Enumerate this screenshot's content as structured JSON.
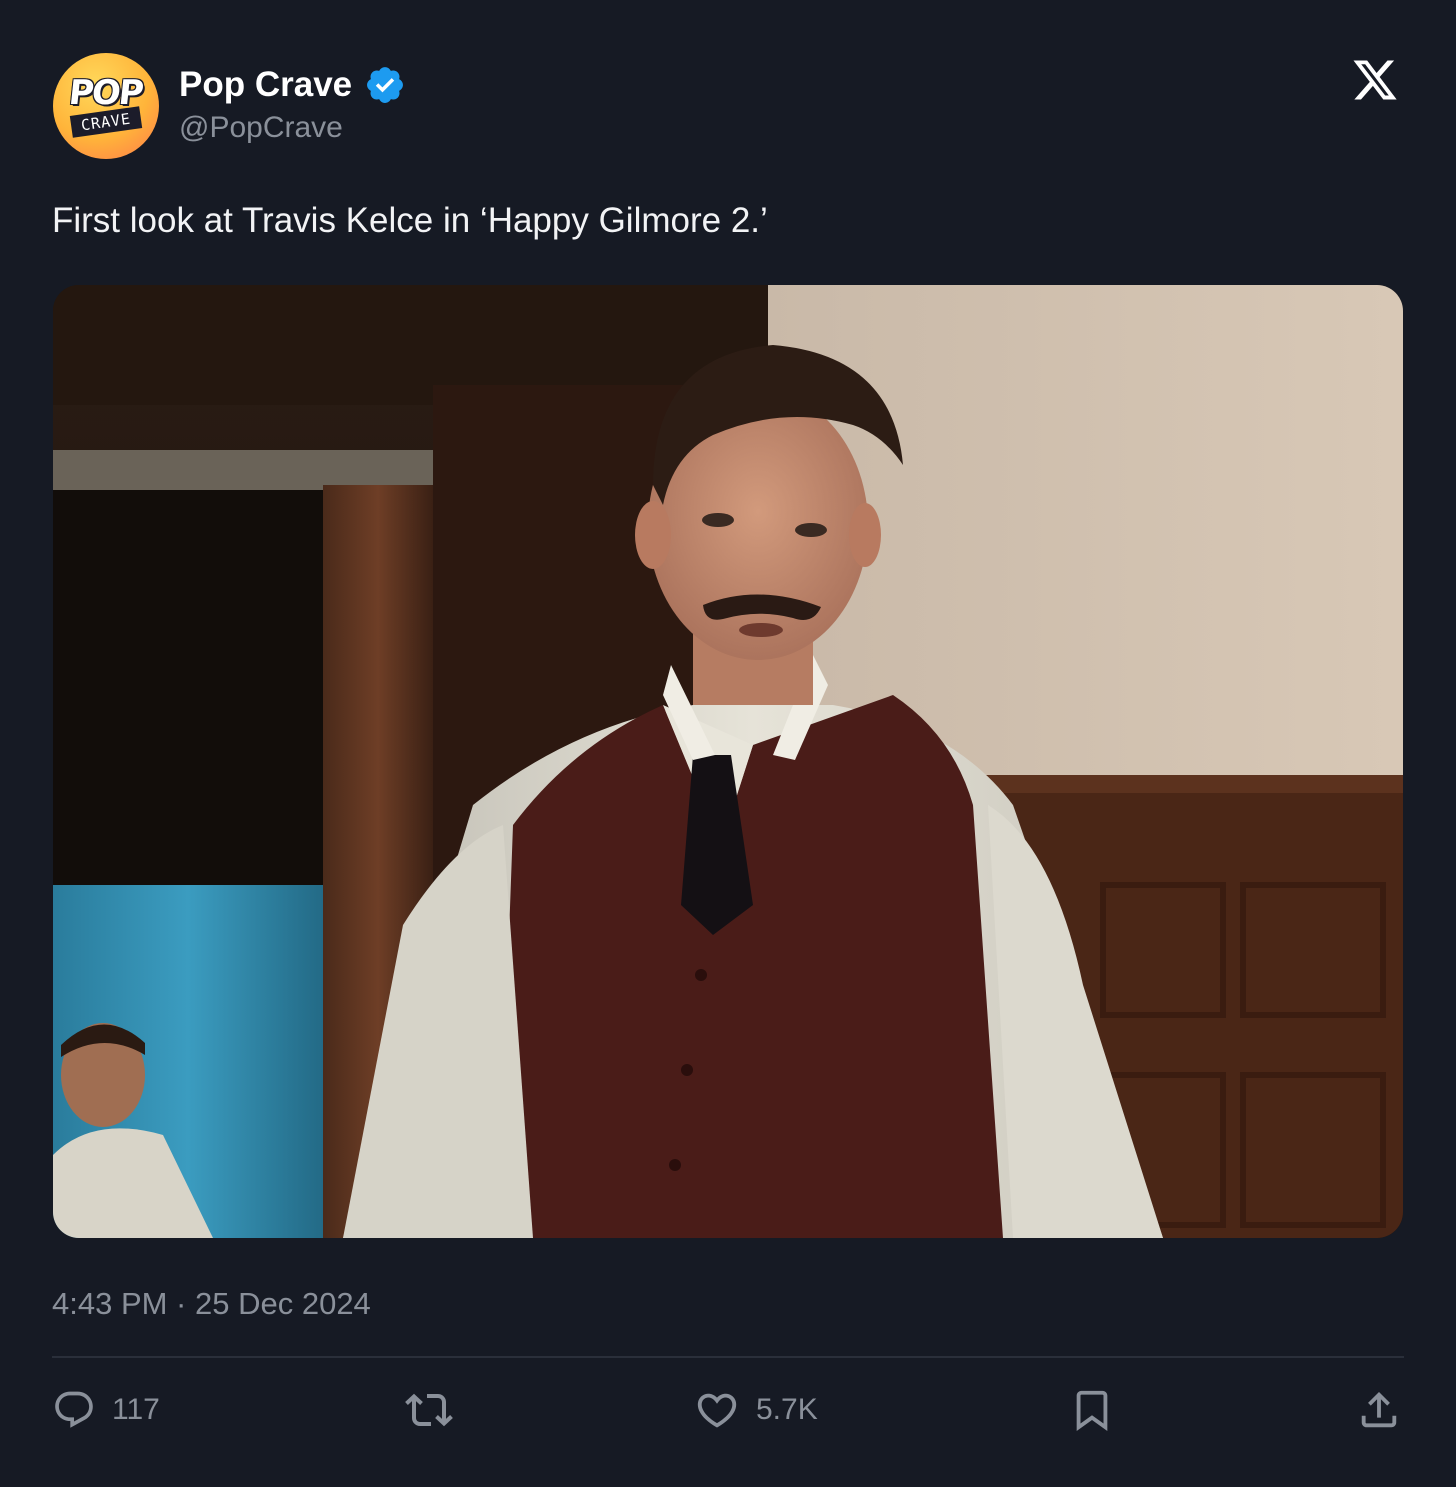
{
  "account": {
    "avatar_top": "POP",
    "avatar_bottom": "CRAVE",
    "display_name": "Pop Crave",
    "handle": "@PopCrave",
    "verified_icon": "verified-badge-icon",
    "platform_icon": "x-logo-icon"
  },
  "post": {
    "text": "First look at Travis Kelce in ‘Happy Gilmore 2.’",
    "timestamp": "4:43 PM · 25 Dec 2024"
  },
  "actions": {
    "replies": {
      "icon": "reply-icon",
      "count": "117"
    },
    "reposts": {
      "icon": "repost-icon",
      "count": ""
    },
    "likes": {
      "icon": "heart-icon",
      "count": "5.7K"
    },
    "bookmark": {
      "icon": "bookmark-icon"
    },
    "share": {
      "icon": "share-icon"
    }
  },
  "colors": {
    "background": "#161a24",
    "text_primary": "#ffffff",
    "text_secondary": "#8a909a",
    "verified_blue": "#1d9bf0",
    "divider": "#2a2f3a"
  }
}
